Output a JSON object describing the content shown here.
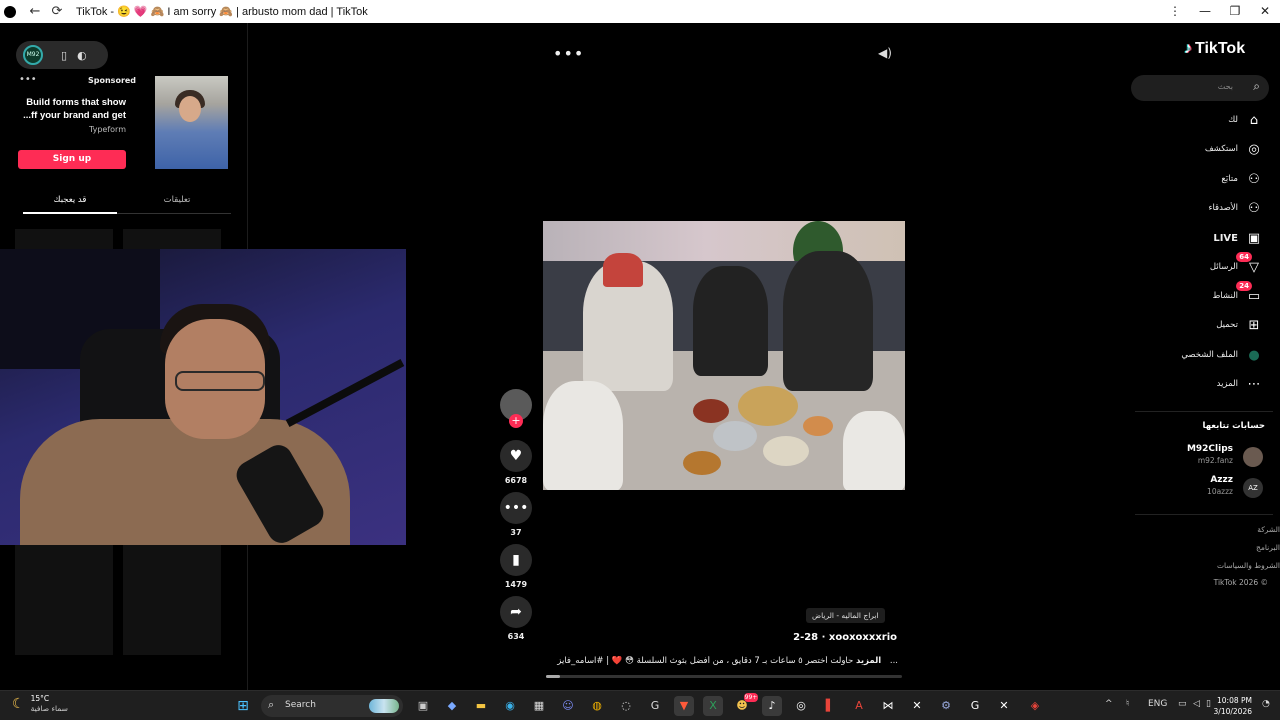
{
  "titlebar": {
    "title": "TikTok - 😉 💗 🙈 I am sorry 🙈 | arbusto mom dad | TikTok",
    "back": "←",
    "reload": "⟳",
    "minimize": "—",
    "restore": "❐",
    "close": "✕",
    "menu": "⋮"
  },
  "left": {
    "ad": {
      "sponsored": "Sponsored",
      "headline": "Build forms that show ...ff your brand and get",
      "brand": "Typeform",
      "cta": "Sign up"
    },
    "tabs": [
      "تعليقات",
      "قد يعجبك"
    ],
    "active_tab": 1
  },
  "video": {
    "likes": "6678",
    "comments": "37",
    "saves": "1479",
    "shares": "634",
    "location": "ابراج الماليه - الرياض",
    "author": "xooxoxxxrio",
    "date": "2-28",
    "description": "حاولت أختصر ٥ ساعات بـ 7 دقايق ، من أفضل بثوث السلسلة 😳 ❤️ | #اسامه_فايز ...",
    "more": "المزيد",
    "progress": 0.04
  },
  "sidebar": {
    "brand": "TikTok",
    "search_placeholder": "بحث",
    "nav": [
      {
        "label": "لك",
        "icon": "home-icon",
        "glyph": "⌂"
      },
      {
        "label": "استكشف",
        "icon": "compass-icon",
        "glyph": "◎"
      },
      {
        "label": "متابَع",
        "icon": "following-icon",
        "glyph": "⚇"
      },
      {
        "label": "الأصدقاء",
        "icon": "friends-icon",
        "glyph": "⚇"
      },
      {
        "label": "LIVE",
        "icon": "live-icon",
        "glyph": "▣"
      },
      {
        "label": "الرسائل",
        "icon": "messages-icon",
        "glyph": "▽",
        "badge": "64"
      },
      {
        "label": "النشاط",
        "icon": "activity-icon",
        "glyph": "▭",
        "badge": "24"
      },
      {
        "label": "تحميل",
        "icon": "upload-icon",
        "glyph": "⊞"
      },
      {
        "label": "الملف الشخصي",
        "icon": "profile-avatar-icon",
        "glyph": "●"
      },
      {
        "label": "المزيد",
        "icon": "more-icon",
        "glyph": "⋯"
      }
    ],
    "following_title": "حسابات تتابعها",
    "accounts": [
      {
        "name": "M92Clips",
        "handle": "m92.fanz"
      },
      {
        "name": "Azzz",
        "handle": "10azzz"
      }
    ],
    "footer": [
      "الشركة",
      "البرنامج",
      "الشروط والسياسات",
      "TikTok 2026 ©"
    ]
  },
  "taskbar": {
    "temp": "15°C",
    "condition": "سماء صافية",
    "search_label": "Search",
    "lang": "ENG",
    "time": "10:08 PM",
    "date": "3/10/2026",
    "badge_app": "99+"
  },
  "colors": {
    "accent": "#fe2c55",
    "background": "#000000",
    "taskbar": "#1f1f1f"
  }
}
